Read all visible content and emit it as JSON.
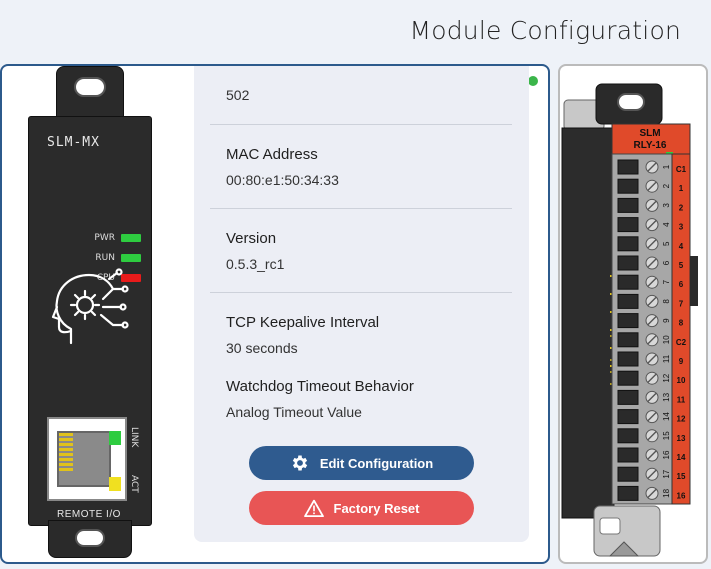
{
  "page": {
    "title": "Module Configuration"
  },
  "device": {
    "model": "SLM-MX",
    "leds": [
      {
        "label": "PWR",
        "color": "#2ecc40"
      },
      {
        "label": "RUN",
        "color": "#2ecc40"
      },
      {
        "label": "CPU",
        "color": "#e81b1b"
      }
    ],
    "port_labels": {
      "link": "LINK",
      "act": "ACT"
    },
    "footer": "REMOTE I/O"
  },
  "status_color": "#3bb54a",
  "fields": [
    {
      "label": "",
      "value": "502"
    },
    {
      "label": "MAC Address",
      "value": "00:80:e1:50:34:33"
    },
    {
      "label": "Version",
      "value": "0.5.3_rc1"
    },
    {
      "label": "TCP Keepalive Interval",
      "value": "30 seconds"
    },
    {
      "label": "Watchdog Timeout Behavior",
      "value": "Analog Timeout Value"
    }
  ],
  "buttons": {
    "edit": "Edit Configuration",
    "reset": "Factory Reset"
  },
  "relay_module": {
    "brand": "SLM",
    "model": "RLY-16",
    "pins": [
      "1",
      "2",
      "3",
      "4",
      "5",
      "6",
      "7",
      "8",
      "9",
      "10",
      "11",
      "12",
      "13",
      "14",
      "15",
      "16",
      "17",
      "18"
    ],
    "terminals": [
      "C1",
      "1",
      "2",
      "3",
      "4",
      "5",
      "6",
      "7",
      "8",
      "C2",
      "9",
      "10",
      "11",
      "12",
      "13",
      "14",
      "15",
      "16"
    ]
  }
}
